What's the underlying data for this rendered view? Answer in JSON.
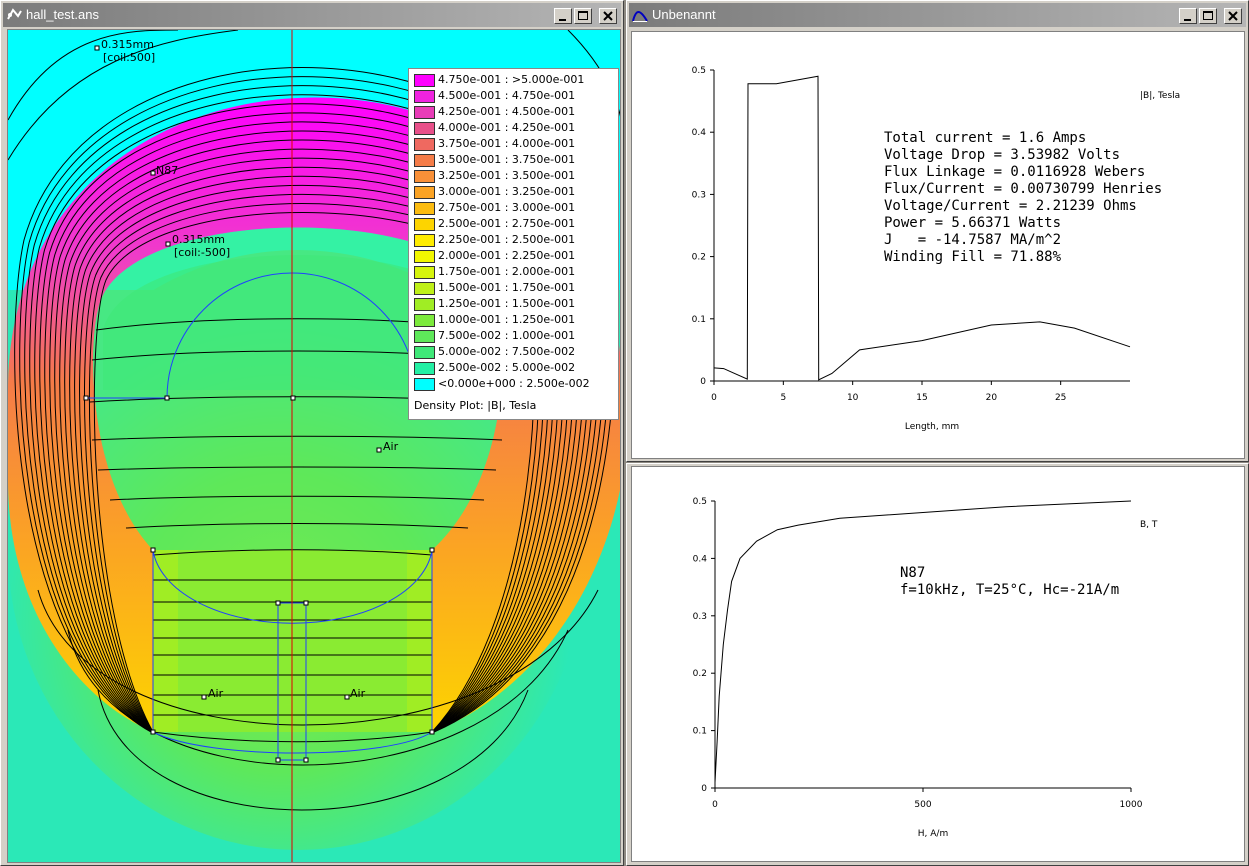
{
  "left_window": {
    "title": "hall_test.ans",
    "labels": {
      "coil1_size": "0.315mm",
      "coil1_circuit": "[coil:500]",
      "coil2_size": "0.315mm",
      "coil2_circuit": "[coil:-500]",
      "material_core": "N87",
      "air_center": "Air",
      "air_left": "Air",
      "air_right": "Air"
    },
    "legend": {
      "title": "Density Plot: |B|, Tesla",
      "items": [
        {
          "range": "4.750e-001 : >5.000e-001",
          "color": "#ff00ff"
        },
        {
          "range": "4.500e-001 : 4.750e-001",
          "color": "#f023e0"
        },
        {
          "range": "4.250e-001 : 4.500e-001",
          "color": "#e83cb8"
        },
        {
          "range": "4.000e-001 : 4.250e-001",
          "color": "#e8508a"
        },
        {
          "range": "3.750e-001 : 4.000e-001",
          "color": "#ef6960"
        },
        {
          "range": "3.500e-001 : 3.750e-001",
          "color": "#f57c48"
        },
        {
          "range": "3.250e-001 : 3.500e-001",
          "color": "#f99038"
        },
        {
          "range": "3.000e-001 : 3.250e-001",
          "color": "#fba324"
        },
        {
          "range": "2.750e-001 : 3.000e-001",
          "color": "#fcbc10"
        },
        {
          "range": "2.500e-001 : 2.750e-001",
          "color": "#fdd400"
        },
        {
          "range": "2.250e-001 : 2.500e-001",
          "color": "#ffec00"
        },
        {
          "range": "2.000e-001 : 2.250e-001",
          "color": "#f2f700"
        },
        {
          "range": "1.750e-001 : 2.000e-001",
          "color": "#d6f40c"
        },
        {
          "range": "1.500e-001 : 1.750e-001",
          "color": "#bff018"
        },
        {
          "range": "1.250e-001 : 1.500e-001",
          "color": "#a0ed24"
        },
        {
          "range": "1.000e-001 : 1.250e-001",
          "color": "#7cea3c"
        },
        {
          "range": "7.500e-002 : 1.000e-001",
          "color": "#5ee85a"
        },
        {
          "range": "5.000e-002 : 7.500e-002",
          "color": "#3fe878"
        },
        {
          "range": "2.500e-002 : 5.000e-002",
          "color": "#23f0a4"
        },
        {
          "range": "<0.000e+000 : 2.500e-002",
          "color": "#00ffff"
        }
      ]
    }
  },
  "top_right_window": {
    "title": "Unbenannt",
    "chart_data": {
      "type": "line",
      "series_label": "|B|, Tesla",
      "xlabel": "Length, mm",
      "xlim": [
        0,
        30
      ],
      "ylim": [
        0,
        0.5
      ],
      "xticks": [
        "0",
        "5",
        "10",
        "15",
        "20",
        "25"
      ],
      "yticks": [
        "0",
        "0.1",
        "0.2",
        "0.3",
        "0.4",
        "0.5"
      ],
      "points": [
        [
          0,
          0.021
        ],
        [
          0.7,
          0.02
        ],
        [
          1.2,
          0.015
        ],
        [
          2.4,
          0.003
        ],
        [
          2.45,
          0.478
        ],
        [
          4.5,
          0.478
        ],
        [
          7.5,
          0.49
        ],
        [
          7.55,
          0.002
        ],
        [
          8.5,
          0.012
        ],
        [
          10.5,
          0.05
        ],
        [
          15,
          0.065
        ],
        [
          20,
          0.09
        ],
        [
          23.5,
          0.095
        ],
        [
          26,
          0.085
        ],
        [
          30,
          0.055
        ]
      ],
      "results": [
        "Total current = 1.6 Amps",
        "Voltage Drop = 3.53982 Volts",
        "Flux Linkage = 0.0116928 Webers",
        "Flux/Current = 0.00730799 Henries",
        "Voltage/Current = 2.21239 Ohms",
        "Power = 5.66371 Watts",
        "J   = -14.7587 MA/m^2",
        "Winding Fill = 71.88%"
      ]
    }
  },
  "bottom_right_window": {
    "chart_data": {
      "type": "line",
      "series_label": "B, T",
      "xlabel": "H, A/m",
      "xlim": [
        0,
        1000
      ],
      "ylim": [
        0,
        0.5
      ],
      "xticks": [
        "0",
        "500",
        "1000"
      ],
      "yticks": [
        "0",
        "0.1",
        "0.2",
        "0.3",
        "0.4",
        "0.5"
      ],
      "points": [
        [
          0,
          0.01
        ],
        [
          5,
          0.08
        ],
        [
          10,
          0.16
        ],
        [
          20,
          0.25
        ],
        [
          30,
          0.31
        ],
        [
          40,
          0.36
        ],
        [
          60,
          0.4
        ],
        [
          100,
          0.43
        ],
        [
          150,
          0.45
        ],
        [
          200,
          0.458
        ],
        [
          300,
          0.47
        ],
        [
          500,
          0.48
        ],
        [
          700,
          0.49
        ],
        [
          1000,
          0.5
        ]
      ],
      "material_name": "N87",
      "material_props": "f=10kHz, T=25°C, Hc=-21A/m"
    }
  }
}
